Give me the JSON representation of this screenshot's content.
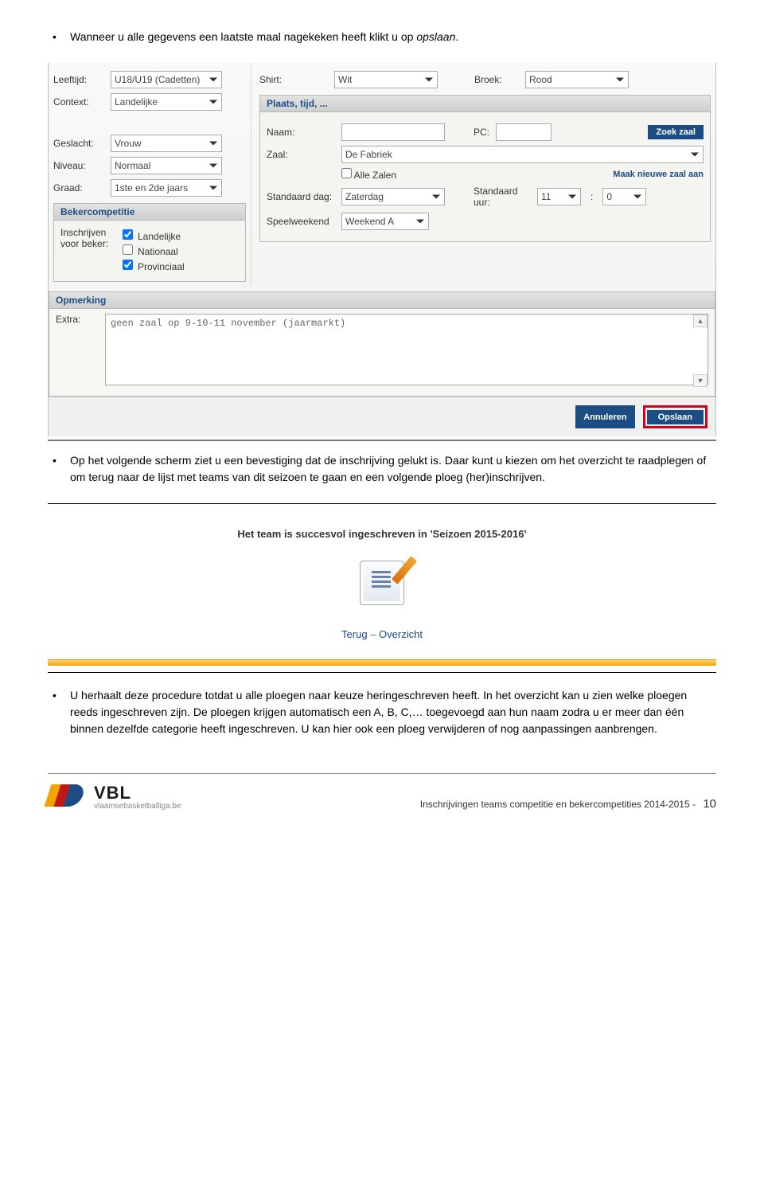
{
  "bullet1_prefix": "Wanneer u alle gegevens een laatste maal nagekeken heeft klikt u op ",
  "bullet1_action": "opslaan",
  "bullet1_suffix": ".",
  "form": {
    "left": {
      "leeftijd_lbl": "Leeftijd:",
      "leeftijd_val": "U18/U19 (Cadetten)",
      "context_lbl": "Context:",
      "context_val": "Landelijke",
      "geslacht_lbl": "Geslacht:",
      "geslacht_val": "Vrouw",
      "niveau_lbl": "Niveau:",
      "niveau_val": "Normaal",
      "graad_lbl": "Graad:",
      "graad_val": "1ste en 2de jaars",
      "beker_head": "Bekercompetitie",
      "beker_lbl": "Inschrijven voor beker:",
      "cb_landelijke": "Landelijke",
      "cb_nationaal": "Nationaal",
      "cb_provinciaal": "Provinciaal"
    },
    "right": {
      "shirt_lbl": "Shirt:",
      "shirt_val": "Wit",
      "broek_lbl": "Broek:",
      "broek_val": "Rood",
      "plaats_head": "Plaats, tijd, ...",
      "naam_lbl": "Naam:",
      "pc_lbl": "PC:",
      "zoekzaal_btn": "Zoek zaal",
      "zaal_lbl": "Zaal:",
      "zaal_val": "De Fabriek",
      "allezalen_lbl": "Alle Zalen",
      "maakzaal_link": "Maak nieuwe zaal aan",
      "stddag_lbl": "Standaard dag:",
      "stddag_val": "Zaterdag",
      "stduur_lbl": "Standaard uur:",
      "stduur_h": "11",
      "stduur_m": "0",
      "speelwk_lbl": "Speelweekend",
      "speelwk_val": "Weekend A"
    },
    "opm_head": "Opmerking",
    "extra_lbl": "Extra:",
    "extra_val": "geen zaal op 9-10-11 november (jaarmarkt)",
    "annuleren_btn": "Annuleren",
    "opslaan_btn": "Opslaan"
  },
  "bullet2": "Op het volgende scherm ziet u een bevestiging dat de inschrijving gelukt is. Daar kunt u kiezen om het overzicht te raadplegen of om terug naar de lijst met teams van dit seizoen te gaan en een volgende ploeg (her)inschrijven.",
  "confirm": {
    "title": "Het team is succesvol ingeschreven in 'Seizoen 2015-2016'",
    "terug": "Terug",
    "overzicht": "Overzicht"
  },
  "bullet3": "U herhaalt deze procedure totdat u alle ploegen naar keuze heringeschreven heeft. In het overzicht kan u zien welke ploegen reeds ingeschreven zijn. De ploegen krijgen automatisch een A, B, C,… toegevoegd aan hun naam zodra u er meer dan één binnen dezelfde categorie heeft ingeschreven. U kan hier ook een ploeg verwijderen of nog aanpassingen aanbrengen.",
  "footer": {
    "logo_text": "VBL",
    "logo_url": "vlaamsebasketballiga.be",
    "doc_title": "Inschrijvingen teams competitie en bekercompetities 2014-2015  -",
    "page_num": "10"
  }
}
